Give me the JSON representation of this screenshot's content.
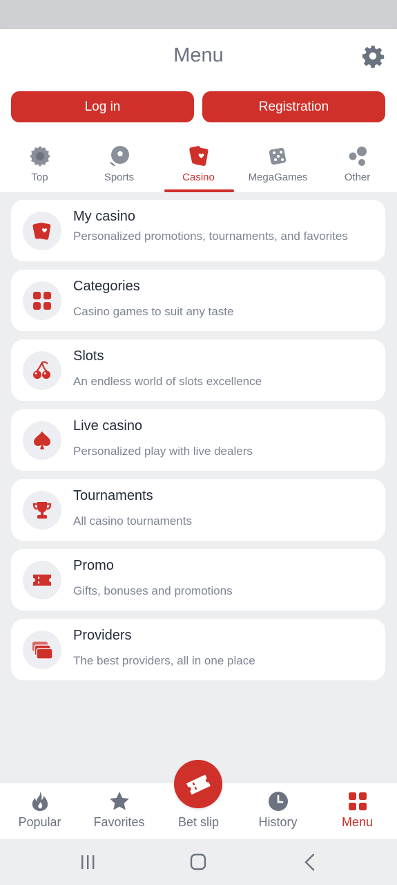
{
  "header": {
    "title": "Menu"
  },
  "auth": {
    "login_label": "Log in",
    "register_label": "Registration"
  },
  "tabs": [
    {
      "label": "Top",
      "icon": "gear-badge-icon"
    },
    {
      "label": "Sports",
      "icon": "soccer-ball-icon"
    },
    {
      "label": "Casino",
      "icon": "playing-cards-icon",
      "active": true
    },
    {
      "label": "MegaGames",
      "icon": "dice-icon"
    },
    {
      "label": "Other",
      "icon": "bubbles-icon"
    }
  ],
  "menu_items": [
    {
      "title": "My casino",
      "subtitle": "Personalized promotions, tournaments, and favorites",
      "icon": "playing-cards-icon"
    },
    {
      "title": "Categories",
      "subtitle": "Casino games to suit any taste",
      "icon": "grid-icon"
    },
    {
      "title": "Slots",
      "subtitle": "An endless world of slots excellence",
      "icon": "cherries-icon"
    },
    {
      "title": "Live casino",
      "subtitle": "Personalized play with live dealers",
      "icon": "spade-icon"
    },
    {
      "title": "Tournaments",
      "subtitle": "All casino tournaments",
      "icon": "trophy-icon"
    },
    {
      "title": "Promo",
      "subtitle": "Gifts, bonuses and promotions",
      "icon": "ticket-icon"
    },
    {
      "title": "Providers",
      "subtitle": "The best providers, all in one place",
      "icon": "stacked-cards-icon"
    }
  ],
  "bottom_nav": [
    {
      "label": "Popular",
      "icon": "flame-icon"
    },
    {
      "label": "Favorites",
      "icon": "star-icon"
    },
    {
      "label": "Bet slip",
      "icon": "ticket-icon"
    },
    {
      "label": "History",
      "icon": "clock-icon"
    },
    {
      "label": "Menu",
      "icon": "grid-icon",
      "active": true
    }
  ],
  "colors": {
    "accent": "#d0302a",
    "muted": "#6b7380",
    "background": "#edeef0"
  }
}
